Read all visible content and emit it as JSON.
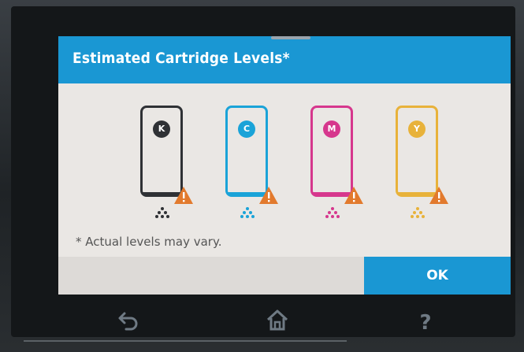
{
  "dialog": {
    "title": "Estimated Cartridge Levels*",
    "footnote": "* Actual levels may vary.",
    "ok_label": "OK"
  },
  "cartridges": [
    {
      "letter": "K",
      "color": "#2f3135",
      "level": 0.02,
      "status": "low"
    },
    {
      "letter": "C",
      "color": "#1aa3d8",
      "level": 0.02,
      "status": "low"
    },
    {
      "letter": "M",
      "color": "#d6378d",
      "level": 0.02,
      "status": "low"
    },
    {
      "letter": "Y",
      "color": "#e8b23a",
      "level": 0.02,
      "status": "low"
    }
  ],
  "warning_color": "#e27a2d",
  "nav": {
    "back_icon": "back-icon",
    "home_icon": "home-icon",
    "help_label": "?"
  }
}
